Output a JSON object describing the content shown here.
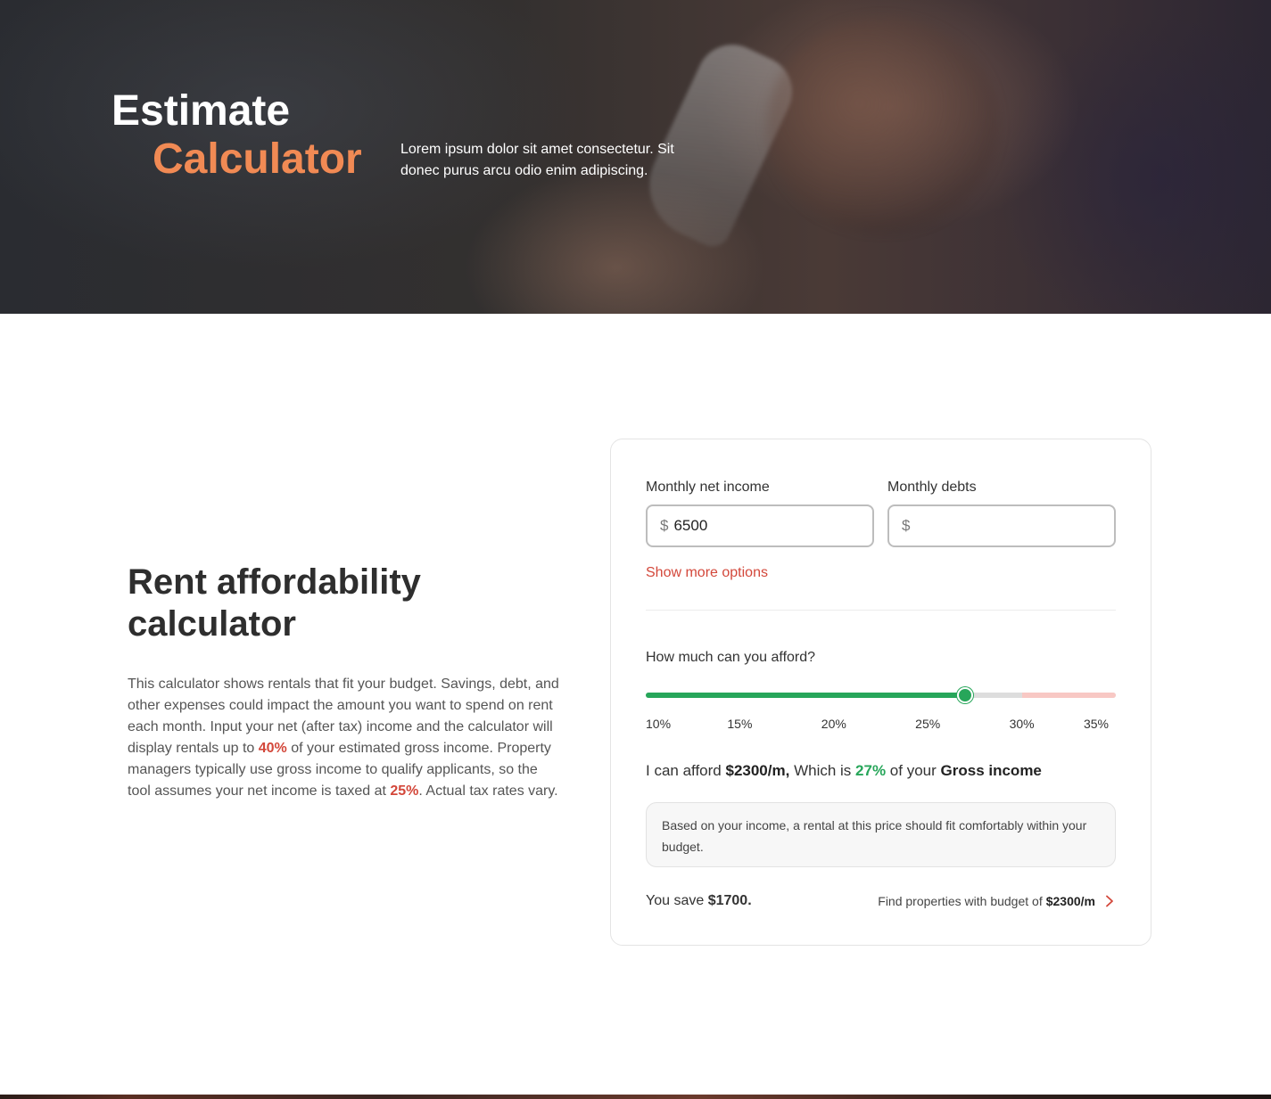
{
  "hero": {
    "title_line1": "Estimate",
    "title_line2": "Calculator",
    "subtitle": "Lorem ipsum dolor sit amet consectetur. Sit donec purus arcu odio enim adipiscing."
  },
  "intro": {
    "heading": "Rent affordability calculator",
    "text_1": "This calculator shows rentals that fit your budget. Savings, debt, and other expenses could impact the amount you want to spend on rent each month. Input your net (after tax) income and the calculator will display rentals up to ",
    "highlight_1": "40%",
    "text_2": " of your estimated gross income. Property managers typically use gross income to qualify applicants, so the tool assumes your net income is taxed at ",
    "highlight_2": "25%",
    "text_3": ". Actual tax rates vary."
  },
  "calculator": {
    "income_label": "Monthly net income",
    "income_currency": "$",
    "income_value": "6500",
    "debts_label": "Monthly debts",
    "debts_currency": "$",
    "debts_value": "",
    "show_more": "Show more options",
    "afford_question": "How much can you afford?",
    "slider": {
      "min": 10,
      "max": 35,
      "value": 27,
      "comfort_limit": 30,
      "ticks": [
        "10%",
        "15%",
        "20%",
        "25%",
        "30%",
        "35%"
      ],
      "fill_color": "#27a65a",
      "over_color": "#f8c8c4"
    },
    "result": {
      "prefix": "I can afford",
      "amount": "$2300/m,",
      "middle": "Which is",
      "percent": "27%",
      "middle2": "of your",
      "basis": "Gross income"
    },
    "note": "Based on your income, a rental at this price should fit comfortably within your budget.",
    "save_prefix": "You save",
    "save_amount": "$1700.",
    "find_label": "Find properties with budget of",
    "find_amount": "$2300/m"
  },
  "colors": {
    "accent": "#f18a54",
    "highlight_red": "#d3473a",
    "success_green": "#27a65a"
  }
}
